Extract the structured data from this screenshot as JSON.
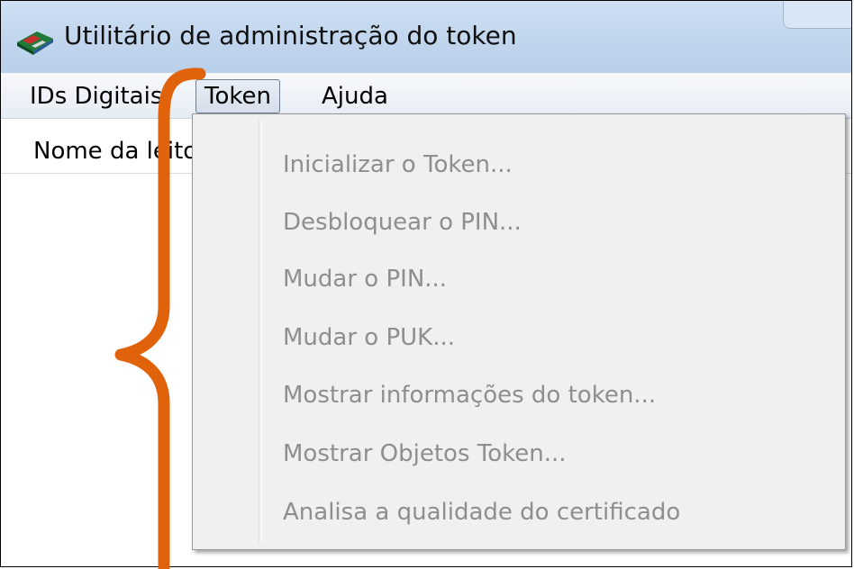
{
  "window": {
    "title": "Utilitário de administração do token"
  },
  "menubar": {
    "items": [
      {
        "label": "IDs Digitais"
      },
      {
        "label": "Token"
      },
      {
        "label": "Ajuda"
      }
    ]
  },
  "list": {
    "column_header": "Nome da leitora"
  },
  "token_menu": {
    "items": [
      {
        "label": "Inicializar o Token...",
        "enabled": false
      },
      {
        "label": "Desbloquear o PIN...",
        "enabled": false
      },
      {
        "label": "Mudar o PIN...",
        "enabled": false
      },
      {
        "label": "Mudar o PUK...",
        "enabled": false
      },
      {
        "label": "Mostrar informações do token...",
        "enabled": false
      },
      {
        "label": "Mostrar Objetos Token...",
        "enabled": false
      },
      {
        "label": "Analisa a qualidade do certificado",
        "enabled": false
      }
    ]
  },
  "annotation": {
    "color": "#e0620a",
    "icon": "curly-brace"
  },
  "colors": {
    "disabled_text": "#8e8e8e",
    "titlebar": "#c3d7ee"
  },
  "icons": {
    "app": "token-card-icon"
  }
}
